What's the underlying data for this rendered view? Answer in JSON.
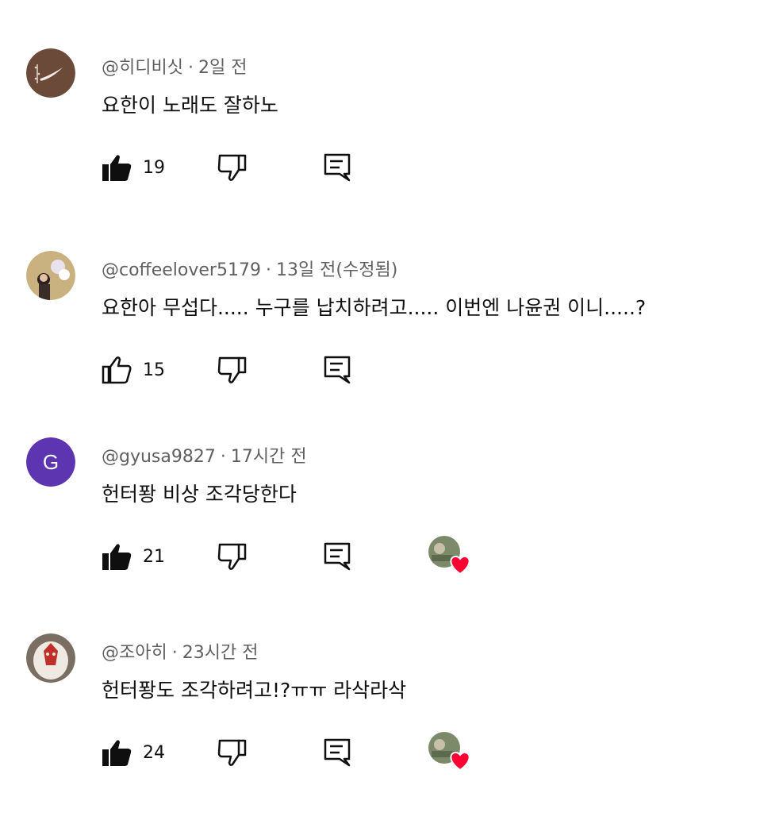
{
  "comments": [
    {
      "author": "@히디비싯",
      "time": "2일 전",
      "edited": "",
      "text": "요한이 노래도 잘하노",
      "likes": "19",
      "liked": true,
      "creator_heart": false,
      "avatar": {
        "type": "image",
        "bg": "#6b4a3a"
      }
    },
    {
      "author": "@coffeelover5179",
      "time": "13일 전",
      "edited": "(수정됨)",
      "text": "요한아 무섭다..... 누구를 납치하려고..... 이번엔 나윤권 이니.....?",
      "likes": "15",
      "liked": false,
      "creator_heart": false,
      "avatar": {
        "type": "image",
        "bg": "#c9b27f"
      }
    },
    {
      "author": "@gyusa9827",
      "time": "17시간 전",
      "edited": "",
      "text": "헌터퐝 비상 조각당한다",
      "likes": "21",
      "liked": true,
      "creator_heart": true,
      "avatar": {
        "type": "letter",
        "letter": "G",
        "bg": "#5e35b1"
      }
    },
    {
      "author": "@조아히",
      "time": "23시간 전",
      "edited": "",
      "text": "헌터퐝도 조각하려고!?ㅠㅠ 라삭라삭",
      "likes": "24",
      "liked": true,
      "creator_heart": true,
      "avatar": {
        "type": "image",
        "bg": "#7a6e62"
      }
    }
  ],
  "separator": "·",
  "icons": {
    "like": "thumbs-up-icon",
    "dislike": "thumbs-down-icon",
    "reply": "reply-icon",
    "heart": "creator-heart-icon"
  },
  "colors": {
    "text": "#0f0f0f",
    "meta": "#606060",
    "heart": "#ff0033"
  }
}
